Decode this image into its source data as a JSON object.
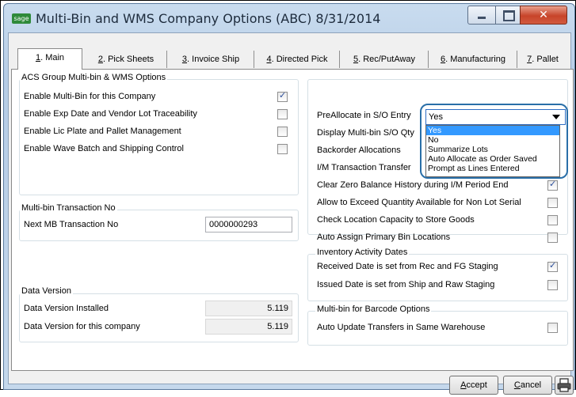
{
  "window": {
    "icon_text": "sage",
    "title": "Multi-Bin and WMS Company Options (ABC) 8/31/2014"
  },
  "tabs": [
    {
      "key": "1",
      "label": ". Main"
    },
    {
      "key": "2",
      "label": ". Pick Sheets"
    },
    {
      "key": "3",
      "label": ". Invoice Ship"
    },
    {
      "key": "4",
      "label": ". Directed Pick"
    },
    {
      "key": "5",
      "label": ". Rec/PutAway"
    },
    {
      "key": "6",
      "label": ". Manufacturing"
    },
    {
      "key": "7",
      "label": ". Pallet"
    }
  ],
  "left": {
    "options_group": "ACS Group Multi-bin & WMS Options",
    "options": [
      {
        "label": "Enable Multi-Bin for this Company",
        "checked": true
      },
      {
        "label": "Enable Exp Date and Vendor Lot Traceability",
        "checked": false
      },
      {
        "label": "Enable Lic Plate and Pallet Management",
        "checked": false
      },
      {
        "label": "Enable Wave Batch and Shipping Control",
        "checked": false
      }
    ],
    "txn_group": "Multi-bin Transaction No",
    "txn_label": "Next MB Transaction No",
    "txn_value": "0000000293",
    "version_group": "Data Version",
    "version_installed_label": "Data Version Installed",
    "version_installed_value": "5.119",
    "version_company_label": "Data Version for this company",
    "version_company_value": "5.119"
  },
  "right": {
    "prealloc_label": "PreAllocate in S/O Entry",
    "prealloc_value": "Yes",
    "dropdown_options": [
      "Yes",
      "No",
      "Summarize Lots",
      "Auto Allocate as Order Saved",
      "Prompt as Lines Entered"
    ],
    "rows": [
      {
        "label": "Display Multi-bin S/O Qty",
        "checked": false
      },
      {
        "label": "Backorder Allocations",
        "checked": false
      },
      {
        "label": "I/M Transaction Transfer",
        "checked": false
      },
      {
        "label": "Clear Zero Balance History during I/M Period End",
        "checked": true
      },
      {
        "label": "Allow to Exceed Quantity Available for Non Lot Serial",
        "checked": false
      },
      {
        "label": "Check Location Capacity to Store Goods",
        "checked": false
      },
      {
        "label": "Auto Assign Primary Bin Locations",
        "checked": false
      }
    ],
    "activity_group": "Inventory Activity Dates",
    "activity": [
      {
        "label": "Received Date is set from Rec and FG Staging",
        "checked": true
      },
      {
        "label": "Issued Date is set from Ship and Raw Staging",
        "checked": false
      }
    ],
    "barcode_group": "Multi-bin for Barcode Options",
    "barcode": [
      {
        "label": "Auto Update Transfers in Same Warehouse",
        "checked": false
      }
    ]
  },
  "buttons": {
    "accept_key": "A",
    "accept_rest": "ccept",
    "cancel_key": "C",
    "cancel_rest": "ancel"
  },
  "icons": {
    "minimize": "minimize-icon",
    "maximize": "maximize-icon",
    "close": "close-icon",
    "printer": "printer-icon",
    "dropdown": "chevron-down-icon"
  }
}
